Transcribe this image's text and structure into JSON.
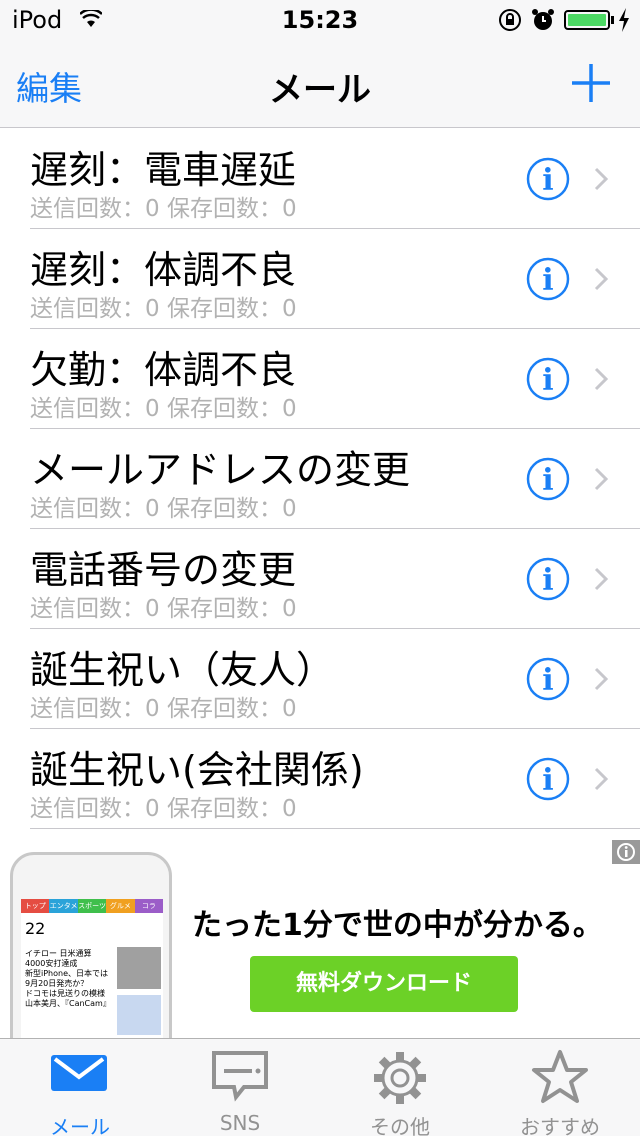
{
  "status_bar": {
    "carrier": "iPod",
    "time": "15:23",
    "battery_level": 1.0,
    "icons": [
      "wifi-icon",
      "orientation-lock-icon",
      "alarm-icon",
      "battery-icon",
      "charging-icon"
    ]
  },
  "nav": {
    "edit_label": "編集",
    "title": "メール",
    "add_icon": "plus-icon"
  },
  "colors": {
    "accent": "#1a7ff5",
    "subtext": "#b2b2b2",
    "battery": "#4cd964",
    "cta": "#6cd127"
  },
  "rows": [
    {
      "name": "遅刻：電車遅延",
      "stats": "送信回数：0 保存回数：0"
    },
    {
      "name": "遅刻：体調不良",
      "stats": "送信回数：0 保存回数：0"
    },
    {
      "name": "欠勤：体調不良",
      "stats": "送信回数：0 保存回数：0"
    },
    {
      "name": "メールアドレスの変更",
      "stats": "送信回数：0 保存回数：0"
    },
    {
      "name": "電話番号の変更",
      "stats": "送信回数：0 保存回数：0"
    },
    {
      "name": "誕生祝い（友人）",
      "stats": "送信回数：0 保存回数：0"
    },
    {
      "name": "誕生祝い(会社関係)",
      "stats": "送信回数：0 保存回数：0"
    }
  ],
  "ad": {
    "headline": "たった1分で世の中が分かる。",
    "cta_label": "無料ダウンロード",
    "phone_tabs": [
      "トップ",
      "エンタメ",
      "スポーツ",
      "グルメ",
      "コラ"
    ],
    "phone_date": "22",
    "phone_news": [
      "イチロー 日米通算",
      "4000安打達成",
      "新型iPhone、日本では",
      "9月20日発売か？",
      "ドコモは見送りの模様",
      "山本美月、『CanCam』"
    ]
  },
  "tabs": [
    {
      "label": "メール",
      "icon": "mail-icon",
      "active": true
    },
    {
      "label": "SNS",
      "icon": "chat-bubble-icon",
      "active": false
    },
    {
      "label": "その他",
      "icon": "gear-icon",
      "active": false
    },
    {
      "label": "おすすめ",
      "icon": "star-icon",
      "active": false
    }
  ]
}
